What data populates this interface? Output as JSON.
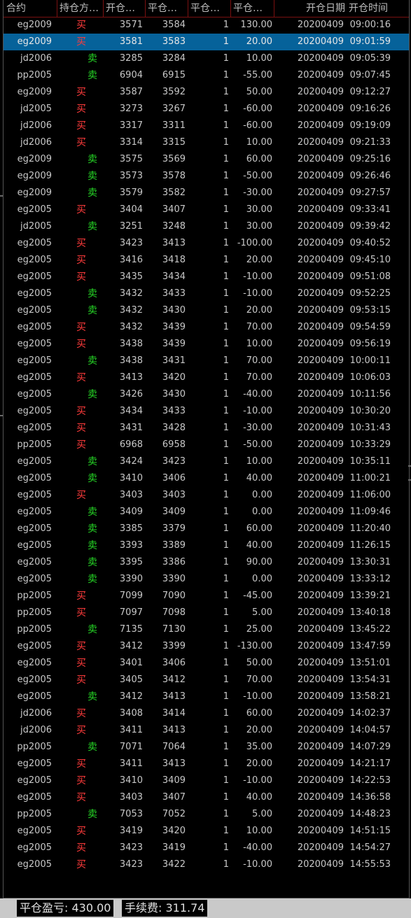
{
  "columns": [
    {
      "key": "contract",
      "label": "合约"
    },
    {
      "key": "direction",
      "label": "持仓方…"
    },
    {
      "key": "open_price",
      "label": "开仓…"
    },
    {
      "key": "close_price",
      "label": "平仓…"
    },
    {
      "key": "qty",
      "label": "平仓…"
    },
    {
      "key": "pnl",
      "label": "平仓…"
    },
    {
      "key": "open_date",
      "label": "开仓日期"
    },
    {
      "key": "open_time",
      "label": "开仓时间"
    }
  ],
  "colors": {
    "buy": "#ff3b3b",
    "sell": "#26d626",
    "selected_row": "#06629a",
    "header_divider": "#7a1010"
  },
  "selected_row_index": 1,
  "rows": [
    {
      "contract": "eg2009",
      "direction": "买",
      "side": "buy",
      "open_price": "3571",
      "close_price": "3584",
      "qty": "1",
      "pnl": "130.00",
      "open_date": "20200409",
      "open_time": "09:00:16"
    },
    {
      "contract": "eg2009",
      "direction": "买",
      "side": "buy",
      "open_price": "3581",
      "close_price": "3583",
      "qty": "1",
      "pnl": "20.00",
      "open_date": "20200409",
      "open_time": "09:01:59"
    },
    {
      "contract": "jd2006",
      "direction": "卖",
      "side": "sell",
      "open_price": "3285",
      "close_price": "3284",
      "qty": "1",
      "pnl": "10.00",
      "open_date": "20200409",
      "open_time": "09:05:39"
    },
    {
      "contract": "pp2005",
      "direction": "卖",
      "side": "sell",
      "open_price": "6904",
      "close_price": "6915",
      "qty": "1",
      "pnl": "-55.00",
      "open_date": "20200409",
      "open_time": "09:07:45"
    },
    {
      "contract": "eg2009",
      "direction": "买",
      "side": "buy",
      "open_price": "3587",
      "close_price": "3592",
      "qty": "1",
      "pnl": "50.00",
      "open_date": "20200409",
      "open_time": "09:12:27"
    },
    {
      "contract": "jd2005",
      "direction": "买",
      "side": "buy",
      "open_price": "3273",
      "close_price": "3267",
      "qty": "1",
      "pnl": "-60.00",
      "open_date": "20200409",
      "open_time": "09:16:26"
    },
    {
      "contract": "jd2006",
      "direction": "买",
      "side": "buy",
      "open_price": "3317",
      "close_price": "3311",
      "qty": "1",
      "pnl": "-60.00",
      "open_date": "20200409",
      "open_time": "09:19:09"
    },
    {
      "contract": "jd2006",
      "direction": "买",
      "side": "buy",
      "open_price": "3314",
      "close_price": "3315",
      "qty": "1",
      "pnl": "10.00",
      "open_date": "20200409",
      "open_time": "09:21:33"
    },
    {
      "contract": "eg2009",
      "direction": "卖",
      "side": "sell",
      "open_price": "3575",
      "close_price": "3569",
      "qty": "1",
      "pnl": "60.00",
      "open_date": "20200409",
      "open_time": "09:25:16"
    },
    {
      "contract": "eg2009",
      "direction": "卖",
      "side": "sell",
      "open_price": "3573",
      "close_price": "3578",
      "qty": "1",
      "pnl": "-50.00",
      "open_date": "20200409",
      "open_time": "09:26:46"
    },
    {
      "contract": "eg2009",
      "direction": "卖",
      "side": "sell",
      "open_price": "3579",
      "close_price": "3582",
      "qty": "1",
      "pnl": "-30.00",
      "open_date": "20200409",
      "open_time": "09:27:57"
    },
    {
      "contract": "eg2005",
      "direction": "买",
      "side": "buy",
      "open_price": "3404",
      "close_price": "3407",
      "qty": "1",
      "pnl": "30.00",
      "open_date": "20200409",
      "open_time": "09:33:41"
    },
    {
      "contract": "jd2005",
      "direction": "卖",
      "side": "sell",
      "open_price": "3251",
      "close_price": "3248",
      "qty": "1",
      "pnl": "30.00",
      "open_date": "20200409",
      "open_time": "09:39:42"
    },
    {
      "contract": "eg2005",
      "direction": "买",
      "side": "buy",
      "open_price": "3423",
      "close_price": "3413",
      "qty": "1",
      "pnl": "-100.00",
      "open_date": "20200409",
      "open_time": "09:40:52"
    },
    {
      "contract": "eg2005",
      "direction": "买",
      "side": "buy",
      "open_price": "3416",
      "close_price": "3418",
      "qty": "1",
      "pnl": "20.00",
      "open_date": "20200409",
      "open_time": "09:45:10"
    },
    {
      "contract": "eg2005",
      "direction": "买",
      "side": "buy",
      "open_price": "3435",
      "close_price": "3434",
      "qty": "1",
      "pnl": "-10.00",
      "open_date": "20200409",
      "open_time": "09:51:08"
    },
    {
      "contract": "eg2005",
      "direction": "卖",
      "side": "sell",
      "open_price": "3432",
      "close_price": "3433",
      "qty": "1",
      "pnl": "-10.00",
      "open_date": "20200409",
      "open_time": "09:52:25"
    },
    {
      "contract": "eg2005",
      "direction": "卖",
      "side": "sell",
      "open_price": "3432",
      "close_price": "3430",
      "qty": "1",
      "pnl": "20.00",
      "open_date": "20200409",
      "open_time": "09:53:15"
    },
    {
      "contract": "eg2005",
      "direction": "买",
      "side": "buy",
      "open_price": "3432",
      "close_price": "3439",
      "qty": "1",
      "pnl": "70.00",
      "open_date": "20200409",
      "open_time": "09:54:59"
    },
    {
      "contract": "eg2005",
      "direction": "买",
      "side": "buy",
      "open_price": "3438",
      "close_price": "3439",
      "qty": "1",
      "pnl": "10.00",
      "open_date": "20200409",
      "open_time": "09:56:19"
    },
    {
      "contract": "eg2005",
      "direction": "卖",
      "side": "sell",
      "open_price": "3438",
      "close_price": "3431",
      "qty": "1",
      "pnl": "70.00",
      "open_date": "20200409",
      "open_time": "10:00:11"
    },
    {
      "contract": "eg2005",
      "direction": "买",
      "side": "buy",
      "open_price": "3413",
      "close_price": "3420",
      "qty": "1",
      "pnl": "70.00",
      "open_date": "20200409",
      "open_time": "10:06:03"
    },
    {
      "contract": "eg2005",
      "direction": "卖",
      "side": "sell",
      "open_price": "3426",
      "close_price": "3430",
      "qty": "1",
      "pnl": "-40.00",
      "open_date": "20200409",
      "open_time": "10:11:56"
    },
    {
      "contract": "eg2005",
      "direction": "买",
      "side": "buy",
      "open_price": "3434",
      "close_price": "3433",
      "qty": "1",
      "pnl": "-10.00",
      "open_date": "20200409",
      "open_time": "10:30:20"
    },
    {
      "contract": "eg2005",
      "direction": "买",
      "side": "buy",
      "open_price": "3431",
      "close_price": "3428",
      "qty": "1",
      "pnl": "-30.00",
      "open_date": "20200409",
      "open_time": "10:31:43"
    },
    {
      "contract": "pp2005",
      "direction": "买",
      "side": "buy",
      "open_price": "6968",
      "close_price": "6958",
      "qty": "1",
      "pnl": "-50.00",
      "open_date": "20200409",
      "open_time": "10:33:29"
    },
    {
      "contract": "eg2005",
      "direction": "卖",
      "side": "sell",
      "open_price": "3424",
      "close_price": "3423",
      "qty": "1",
      "pnl": "10.00",
      "open_date": "20200409",
      "open_time": "10:35:11"
    },
    {
      "contract": "eg2005",
      "direction": "卖",
      "side": "sell",
      "open_price": "3410",
      "close_price": "3406",
      "qty": "1",
      "pnl": "40.00",
      "open_date": "20200409",
      "open_time": "11:00:21"
    },
    {
      "contract": "eg2005",
      "direction": "买",
      "side": "buy",
      "open_price": "3403",
      "close_price": "3403",
      "qty": "1",
      "pnl": "0.00",
      "open_date": "20200409",
      "open_time": "11:06:00"
    },
    {
      "contract": "eg2005",
      "direction": "卖",
      "side": "sell",
      "open_price": "3409",
      "close_price": "3409",
      "qty": "1",
      "pnl": "0.00",
      "open_date": "20200409",
      "open_time": "11:09:46"
    },
    {
      "contract": "eg2005",
      "direction": "卖",
      "side": "sell",
      "open_price": "3385",
      "close_price": "3379",
      "qty": "1",
      "pnl": "60.00",
      "open_date": "20200409",
      "open_time": "11:20:40"
    },
    {
      "contract": "eg2005",
      "direction": "卖",
      "side": "sell",
      "open_price": "3393",
      "close_price": "3389",
      "qty": "1",
      "pnl": "40.00",
      "open_date": "20200409",
      "open_time": "11:26:15"
    },
    {
      "contract": "eg2005",
      "direction": "卖",
      "side": "sell",
      "open_price": "3395",
      "close_price": "3386",
      "qty": "1",
      "pnl": "90.00",
      "open_date": "20200409",
      "open_time": "13:30:31"
    },
    {
      "contract": "eg2005",
      "direction": "卖",
      "side": "sell",
      "open_price": "3390",
      "close_price": "3390",
      "qty": "1",
      "pnl": "0.00",
      "open_date": "20200409",
      "open_time": "13:33:12"
    },
    {
      "contract": "pp2005",
      "direction": "买",
      "side": "buy",
      "open_price": "7099",
      "close_price": "7090",
      "qty": "1",
      "pnl": "-45.00",
      "open_date": "20200409",
      "open_time": "13:39:21"
    },
    {
      "contract": "pp2005",
      "direction": "买",
      "side": "buy",
      "open_price": "7097",
      "close_price": "7098",
      "qty": "1",
      "pnl": "5.00",
      "open_date": "20200409",
      "open_time": "13:40:18"
    },
    {
      "contract": "pp2005",
      "direction": "卖",
      "side": "sell",
      "open_price": "7135",
      "close_price": "7130",
      "qty": "1",
      "pnl": "25.00",
      "open_date": "20200409",
      "open_time": "13:45:22"
    },
    {
      "contract": "eg2005",
      "direction": "买",
      "side": "buy",
      "open_price": "3412",
      "close_price": "3399",
      "qty": "1",
      "pnl": "-130.00",
      "open_date": "20200409",
      "open_time": "13:47:59"
    },
    {
      "contract": "eg2005",
      "direction": "买",
      "side": "buy",
      "open_price": "3401",
      "close_price": "3406",
      "qty": "1",
      "pnl": "50.00",
      "open_date": "20200409",
      "open_time": "13:51:01"
    },
    {
      "contract": "eg2005",
      "direction": "买",
      "side": "buy",
      "open_price": "3405",
      "close_price": "3412",
      "qty": "1",
      "pnl": "70.00",
      "open_date": "20200409",
      "open_time": "13:54:31"
    },
    {
      "contract": "eg2005",
      "direction": "卖",
      "side": "sell",
      "open_price": "3412",
      "close_price": "3413",
      "qty": "1",
      "pnl": "-10.00",
      "open_date": "20200409",
      "open_time": "13:58:21"
    },
    {
      "contract": "jd2006",
      "direction": "买",
      "side": "buy",
      "open_price": "3408",
      "close_price": "3414",
      "qty": "1",
      "pnl": "60.00",
      "open_date": "20200409",
      "open_time": "14:02:37"
    },
    {
      "contract": "jd2006",
      "direction": "买",
      "side": "buy",
      "open_price": "3411",
      "close_price": "3413",
      "qty": "1",
      "pnl": "20.00",
      "open_date": "20200409",
      "open_time": "14:04:57"
    },
    {
      "contract": "pp2005",
      "direction": "卖",
      "side": "sell",
      "open_price": "7071",
      "close_price": "7064",
      "qty": "1",
      "pnl": "35.00",
      "open_date": "20200409",
      "open_time": "14:07:29"
    },
    {
      "contract": "eg2005",
      "direction": "买",
      "side": "buy",
      "open_price": "3411",
      "close_price": "3413",
      "qty": "1",
      "pnl": "20.00",
      "open_date": "20200409",
      "open_time": "14:21:17"
    },
    {
      "contract": "eg2005",
      "direction": "买",
      "side": "buy",
      "open_price": "3410",
      "close_price": "3409",
      "qty": "1",
      "pnl": "-10.00",
      "open_date": "20200409",
      "open_time": "14:22:53"
    },
    {
      "contract": "eg2005",
      "direction": "买",
      "side": "buy",
      "open_price": "3403",
      "close_price": "3407",
      "qty": "1",
      "pnl": "40.00",
      "open_date": "20200409",
      "open_time": "14:36:58"
    },
    {
      "contract": "pp2005",
      "direction": "卖",
      "side": "sell",
      "open_price": "7053",
      "close_price": "7052",
      "qty": "1",
      "pnl": "5.00",
      "open_date": "20200409",
      "open_time": "14:48:23"
    },
    {
      "contract": "eg2005",
      "direction": "买",
      "side": "buy",
      "open_price": "3419",
      "close_price": "3420",
      "qty": "1",
      "pnl": "10.00",
      "open_date": "20200409",
      "open_time": "14:51:15"
    },
    {
      "contract": "eg2005",
      "direction": "买",
      "side": "buy",
      "open_price": "3423",
      "close_price": "3419",
      "qty": "1",
      "pnl": "-40.00",
      "open_date": "20200409",
      "open_time": "14:54:27"
    },
    {
      "contract": "eg2005",
      "direction": "买",
      "side": "buy",
      "open_price": "3423",
      "close_price": "3422",
      "qty": "1",
      "pnl": "-10.00",
      "open_date": "20200409",
      "open_time": "14:55:53"
    }
  ],
  "footer": {
    "pnl_label": "平仓盈亏:",
    "pnl_value": "430.00",
    "fee_label": "手续费:",
    "fee_value": "311.74"
  }
}
